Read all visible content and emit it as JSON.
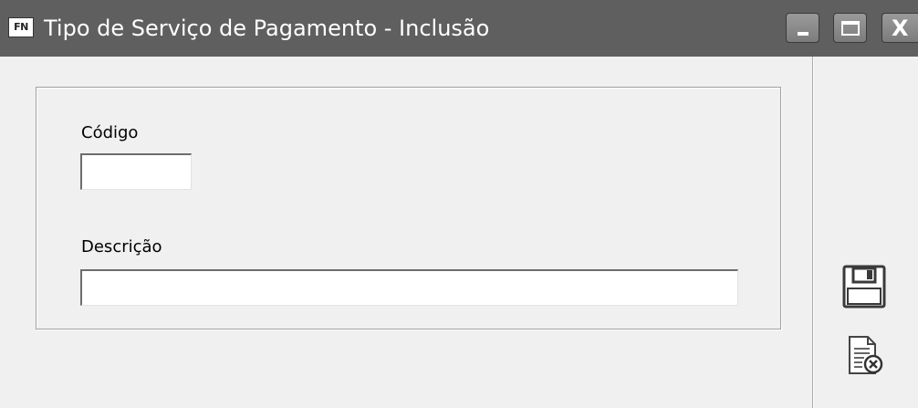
{
  "window": {
    "icon_text": "FN",
    "title": "Tipo de Serviço de Pagamento - Inclusão",
    "controls": {
      "minimize_icon": "minimize-icon",
      "maximize_icon": "maximize-icon",
      "close_icon": "close-icon",
      "close_glyph": "X"
    }
  },
  "form": {
    "codigo": {
      "label": "Código",
      "value": ""
    },
    "descricao": {
      "label": "Descrição",
      "value": ""
    }
  },
  "sidebar": {
    "save_icon": "floppy-disk-icon",
    "cancel_icon": "document-cancel-icon"
  },
  "colors": {
    "titlebar": "#5f5f5f",
    "background": "#f0f0f0",
    "input_background": "#ffffff"
  }
}
